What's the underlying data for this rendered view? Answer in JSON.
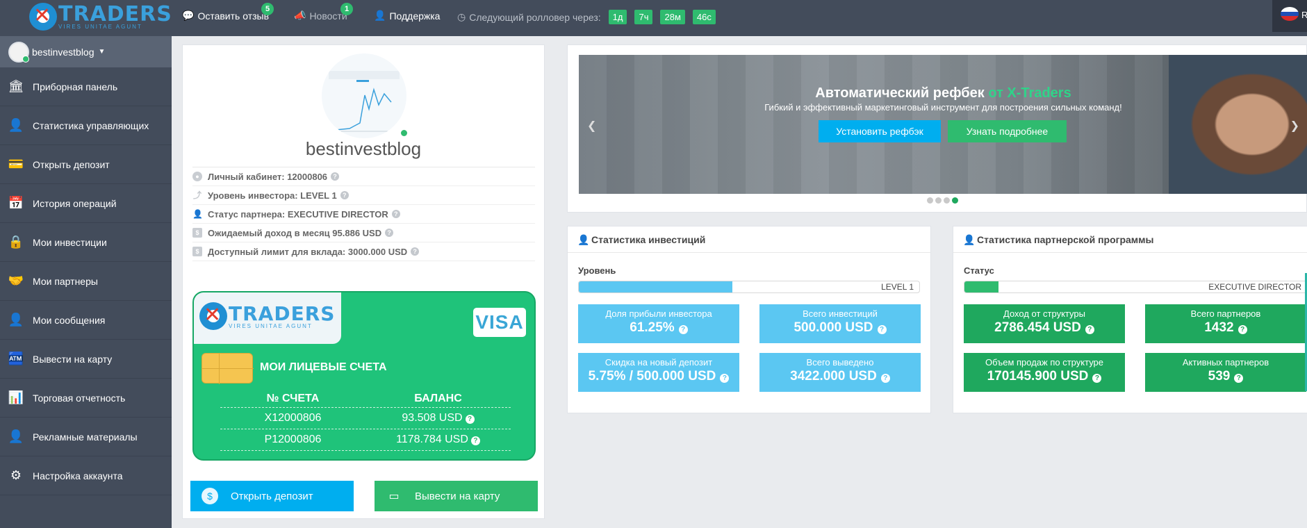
{
  "topbar": {
    "logo_main": "TRADERS",
    "logo_sub": "VIRES UNITAE AGUNT",
    "feedback_label": "Оставить отзыв",
    "feedback_badge": "5",
    "news_label": "Новости",
    "news_badge": "1",
    "support_label": "Поддержка",
    "rollover_label": "Следующий ролловер через:",
    "rollover_parts": [
      "1д",
      "7ч",
      "28м",
      "46с"
    ],
    "lang_label": "RU"
  },
  "sidebar": {
    "username": "bestinvestblog",
    "items": [
      {
        "label": "Приборная панель",
        "icon": "bank-icon"
      },
      {
        "label": "Статистика управляющих",
        "icon": "manager-stats-icon"
      },
      {
        "label": "Открыть депозит",
        "icon": "card-icon"
      },
      {
        "label": "История операций",
        "icon": "calendar-icon"
      },
      {
        "label": "Мои инвестиции",
        "icon": "safe-icon"
      },
      {
        "label": "Мои партнеры",
        "icon": "handshake-icon"
      },
      {
        "label": "Мои сообщения",
        "icon": "user-message-icon"
      },
      {
        "label": "Вывести на карту",
        "icon": "withdraw-icon"
      },
      {
        "label": "Торговая отчетность",
        "icon": "report-icon"
      },
      {
        "label": "Рекламные материалы",
        "icon": "promo-icon"
      },
      {
        "label": "Настройка аккаунта",
        "icon": "settings-user-icon"
      }
    ]
  },
  "profile": {
    "name": "bestinvestblog",
    "info": [
      "Личный кабинет: 12000806",
      "Уровень инвестора: LEVEL 1",
      "Статус партнера: EXECUTIVE DIRECTOR",
      "Ожидаемый доход в месяц 95.886 USD",
      "Доступный лимит для вклада: 3000.000 USD"
    ]
  },
  "card": {
    "logo_main": "TRADERS",
    "logo_sub": "VIRES UNITAE AGUNT",
    "visa": "VISA",
    "title": "МОИ ЛИЦЕВЫЕ СЧЕТА",
    "col_account": "№ СЧЕТА",
    "col_balance": "БАЛАНС",
    "rows": [
      {
        "account": "X12000806",
        "balance": "93.508 USD"
      },
      {
        "account": "P12000806",
        "balance": "1178.784 USD"
      }
    ]
  },
  "actions": {
    "deposit_label": "Открыть депозит",
    "withdraw_label": "Вывести на карту"
  },
  "banner": {
    "title": "Автоматический рефбек",
    "title_highlight": "от X-Traders",
    "subtitle": "Гибкий и эффективный маркетинговый инструмент для построения сильных команд!",
    "button1": "Установить рефбэк",
    "button2": "Узнать подробнее",
    "active_slide": 4,
    "slide_count": 4
  },
  "invest_stats": {
    "title": "Статистика инвестиций",
    "level_label": "Уровень",
    "level_value": "LEVEL 1",
    "level_progress": 0.45,
    "tiles": [
      {
        "label": "Доля прибыли инвестора",
        "value": "61.25%"
      },
      {
        "label": "Всего инвестиций",
        "value": "500.000 USD"
      },
      {
        "label": "Скидка на новый депозит",
        "value": "5.75% / 500.000 USD"
      },
      {
        "label": "Всего выведено",
        "value": "3422.000 USD"
      }
    ]
  },
  "partner_stats": {
    "title": "Статистика партнерской программы",
    "status_label": "Статус",
    "status_value": "EXECUTIVE DIRECTOR",
    "status_progress": 0.1,
    "tiles": [
      {
        "label": "Доход от структуры",
        "value": "2786.454 USD"
      },
      {
        "label": "Всего партнеров",
        "value": "1432"
      },
      {
        "label": "Объем продаж по структуре",
        "value": "170145.900 USD"
      },
      {
        "label": "Активных партнеров",
        "value": "539"
      }
    ]
  },
  "colors": {
    "sidebar_bg": "#434c5b",
    "accent_green": "#2fbb6f",
    "accent_blue": "#00aeef",
    "tile_blue": "#5bc7f2",
    "tile_green": "#1fa85e"
  }
}
